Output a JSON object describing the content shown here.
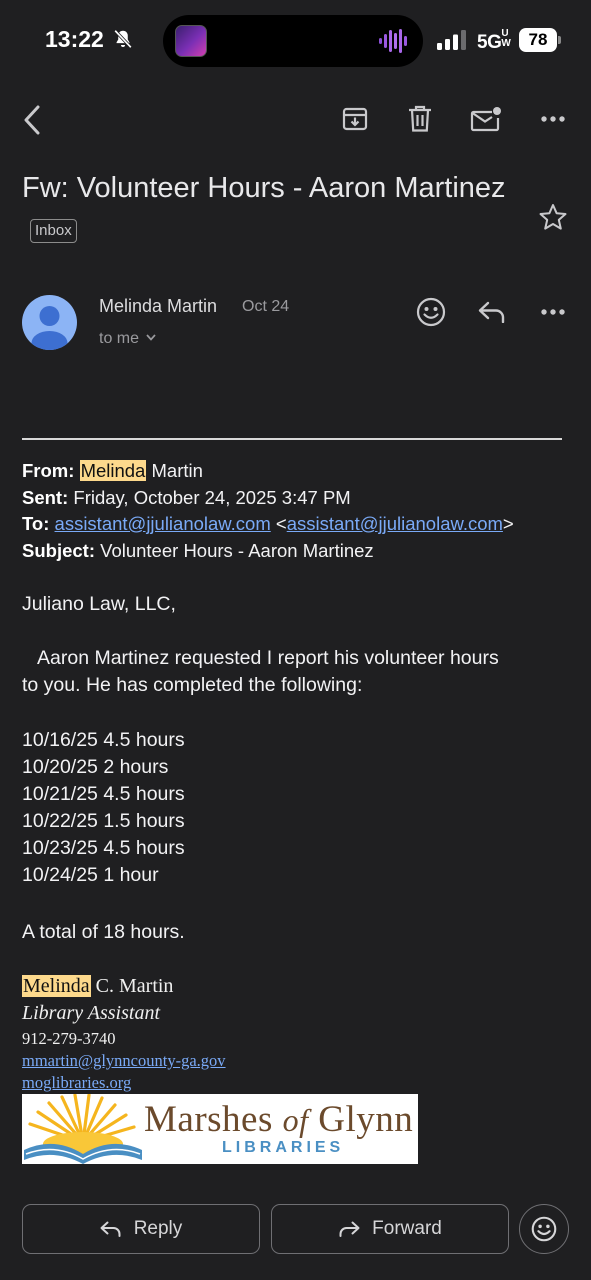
{
  "status_bar": {
    "time": "13:22",
    "network": "5G",
    "network_suffix": "UW",
    "battery": "78"
  },
  "toolbar": {
    "back_icon": "chevron-left-icon",
    "archive_icon": "archive-icon",
    "delete_icon": "trash-icon",
    "mark_unread_icon": "mail-dot-icon",
    "more_icon": "more-horizontal-icon"
  },
  "email": {
    "subject": "Fw: Volunteer Hours - Aaron Martinez",
    "label": "Inbox",
    "sender": "Melinda Martin",
    "date": "Oct 24",
    "recipient": "to me"
  },
  "forward_header": {
    "from_label": "From:",
    "from_highlight": "Melinda",
    "from_rest": "Martin",
    "sent_label": "Sent:",
    "sent_value": "Friday, October 24, 2025 3:47 PM",
    "to_label": "To:",
    "to_email": "assistant@jjulianolaw.com",
    "subject_label": "Subject:",
    "subject_value": "Volunteer Hours - Aaron Martinez"
  },
  "body": {
    "greeting": "Juliano Law, LLC,",
    "intro_line1": "Aaron Martinez requested I report his volunteer hours",
    "intro_line2": "to you. He has completed the following:",
    "hours": [
      "10/16/25 4.5 hours",
      "10/20/25 2 hours",
      "10/21/25 4.5 hours",
      "10/22/25 1.5 hours",
      "10/23/25 4.5 hours",
      "10/24/25 1 hour"
    ],
    "total": "A total of 18 hours."
  },
  "signature": {
    "name_highlight": "Melinda",
    "name_rest": "C. Martin",
    "title": "Library Assistant",
    "phone": "912-279-3740",
    "email": "mmartin@glynncounty-ga.gov",
    "website": "moglibraries.org",
    "logo_main_1": "Marshes",
    "logo_main_of": "of",
    "logo_main_2": "Glynn",
    "logo_sub": "LIBRARIES"
  },
  "actions": {
    "reply": "Reply",
    "forward": "Forward"
  },
  "colors": {
    "background": "#1f1f21",
    "link": "#7aaaf7",
    "highlight": "#fdd98c",
    "avatar": "#8cb4f5"
  }
}
